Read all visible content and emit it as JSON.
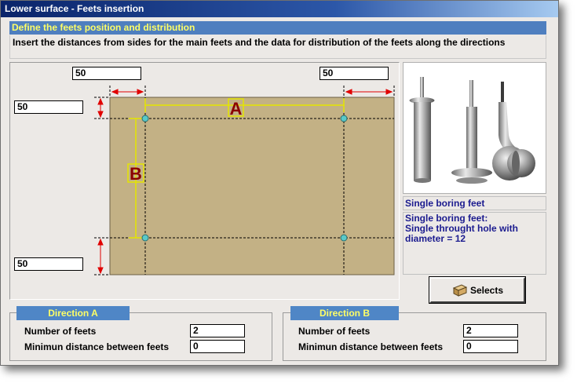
{
  "window": {
    "title": "Lower surface - Feets insertion"
  },
  "section": {
    "header": "Define the feets position and distribution",
    "instruction": "Insert the distances from sides for the main feets and the data for distribution of the feets along the directions"
  },
  "drawing": {
    "top_left_distance": "50",
    "top_right_distance": "50",
    "left_top_distance": "50",
    "left_bottom_distance": "50",
    "label_a": "A",
    "label_b": "B",
    "colors": {
      "board": "#c3b185",
      "dimension": "#e00000",
      "measure": "#e5e500",
      "foot": "#59c9c9"
    }
  },
  "feet": {
    "image_icon": "feet-models-image",
    "name": "Single boring feet",
    "description": "Single boring feet:\nSingle throught hole with\ndiameter = 12"
  },
  "selects": {
    "label": "Selects",
    "icon": "box-icon"
  },
  "direction_a": {
    "title": "Direction A",
    "number_label": "Number of feets",
    "number_value": "2",
    "min_distance_label": "Minimun distance between feets",
    "min_distance_value": "0"
  },
  "direction_b": {
    "title": "Direction B",
    "number_label": "Number of feets",
    "number_value": "2",
    "min_distance_label": "Minimun distance between feets",
    "min_distance_value": "0"
  }
}
